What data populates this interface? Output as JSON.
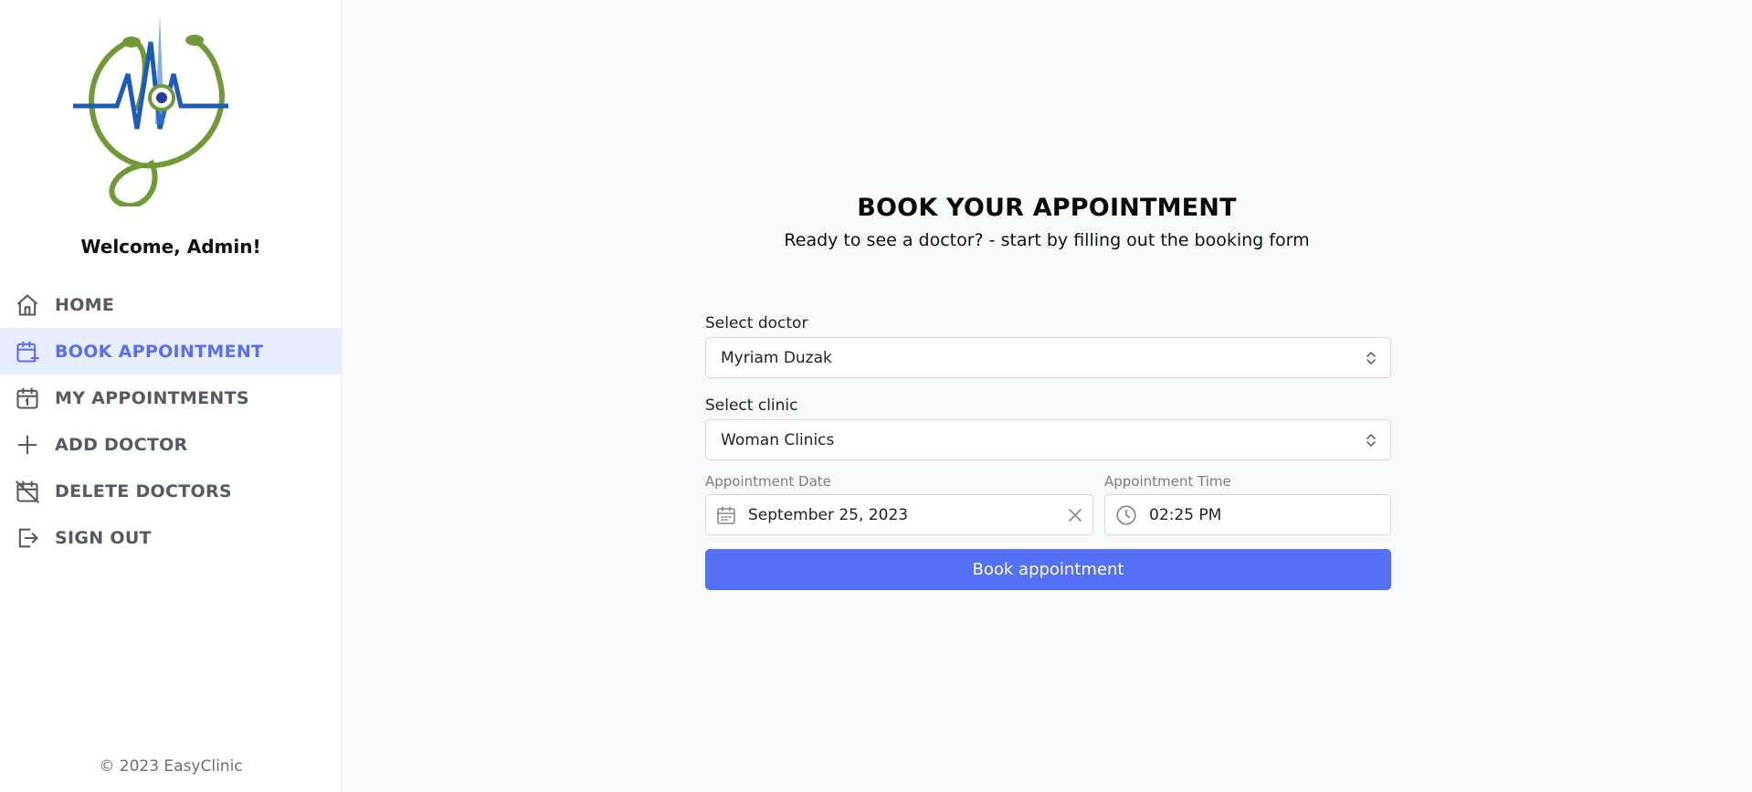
{
  "sidebar": {
    "welcome": "Welcome, Admin!",
    "items": [
      {
        "label": "HOME",
        "icon": "home-icon",
        "active": false
      },
      {
        "label": "BOOK APPOINTMENT",
        "icon": "calendar-plus-icon",
        "active": true
      },
      {
        "label": "MY APPOINTMENTS",
        "icon": "calendar-icon",
        "active": false
      },
      {
        "label": "ADD DOCTOR",
        "icon": "plus-icon",
        "active": false
      },
      {
        "label": "DELETE DOCTORS",
        "icon": "calendar-off-icon",
        "active": false
      },
      {
        "label": "SIGN OUT",
        "icon": "logout-icon",
        "active": false
      }
    ],
    "copyright": "© 2023 EasyClinic"
  },
  "main": {
    "title": "BOOK YOUR APPOINTMENT",
    "subtitle": "Ready to see a doctor? - start by filling out the booking form"
  },
  "form": {
    "doctor_label": "Select doctor",
    "doctor_value": "Myriam Duzak",
    "clinic_label": "Select clinic",
    "clinic_value": "Woman Clinics",
    "date_label": "Appointment Date",
    "date_value": "September 25, 2023",
    "time_label": "Appointment Time",
    "time_value": "02:25 PM",
    "submit_label": "Book appointment"
  },
  "colors": {
    "accent": "#5470f5",
    "active_bg": "#e8eeff",
    "logo_green": "#6f9a37",
    "logo_blue": "#1e5bb8"
  }
}
